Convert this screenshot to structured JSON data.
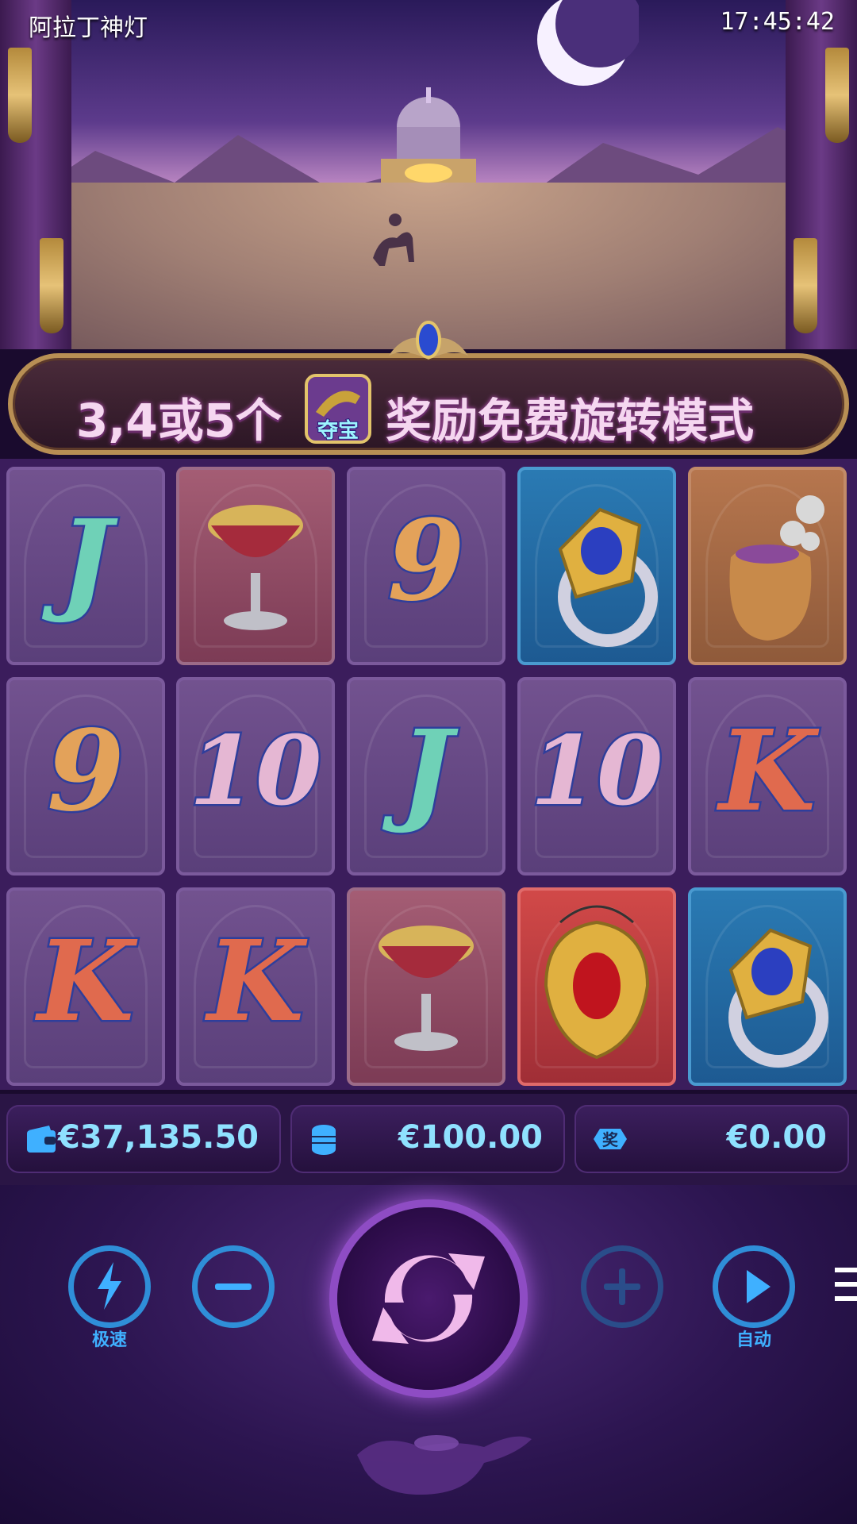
{
  "header": {
    "title": "阿拉丁神灯",
    "time": "17:45:42"
  },
  "banner": {
    "text_before": "3,4或5个",
    "badge_label": "夺宝",
    "text_after": "奖励免费旋转模式"
  },
  "reels": [
    [
      {
        "symbol": "J",
        "type": "letter-j",
        "bg": "purple"
      },
      {
        "symbol": "9",
        "type": "letter-nine",
        "bg": "purple"
      },
      {
        "symbol": "K",
        "type": "letter-k",
        "bg": "purple"
      }
    ],
    [
      {
        "symbol": "goblet",
        "type": "icon",
        "bg": "red"
      },
      {
        "symbol": "10",
        "type": "letter-ten",
        "bg": "purple"
      },
      {
        "symbol": "K",
        "type": "letter-k",
        "bg": "purple"
      }
    ],
    [
      {
        "symbol": "9",
        "type": "letter-nine",
        "bg": "purple"
      },
      {
        "symbol": "J",
        "type": "letter-j",
        "bg": "purple"
      },
      {
        "symbol": "goblet",
        "type": "icon",
        "bg": "red"
      }
    ],
    [
      {
        "symbol": "ring",
        "type": "icon",
        "bg": "blue"
      },
      {
        "symbol": "10",
        "type": "letter-ten",
        "bg": "purple"
      },
      {
        "symbol": "amulet",
        "type": "icon",
        "bg": "bright-red"
      }
    ],
    [
      {
        "symbol": "coin-pouch",
        "type": "icon",
        "bg": "orange"
      },
      {
        "symbol": "K",
        "type": "letter-k",
        "bg": "purple"
      },
      {
        "symbol": "ring",
        "type": "icon",
        "bg": "blue"
      }
    ]
  ],
  "info": {
    "balance": "€37,135.50",
    "bet": "€100.00",
    "win": "€0.00",
    "balance_icon": "wallet-icon",
    "bet_icon": "coin-stack-icon",
    "win_icon": "prize-icon",
    "win_icon_char": "奖"
  },
  "controls": {
    "turbo_label": "极速",
    "auto_label": "自动"
  },
  "colors": {
    "accent_blue": "#2f8ed8",
    "value_cyan": "#8fe1ff",
    "spin_glow": "#a35ad6"
  }
}
